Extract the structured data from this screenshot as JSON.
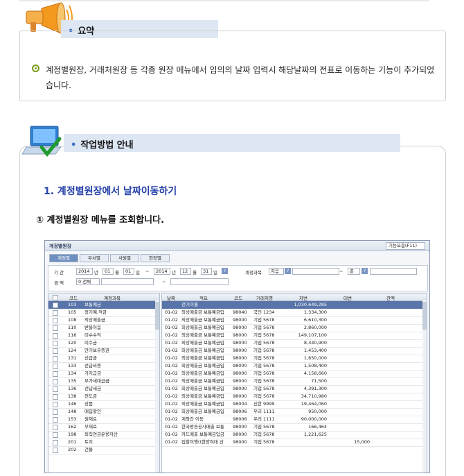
{
  "summary": {
    "title": "요약",
    "text": "계정별원장, 거래처원장 등 각종 원장 메뉴에서 임의의 날짜 입력시 해당날짜의 전표로 이동하는 기능이 추가되었습니다."
  },
  "guide": {
    "title": "작업방법 안내",
    "step_heading": "1. 계정별원장에서 날짜이동하기",
    "step_1": "① 계정별원장 메뉴를 조회합니다."
  },
  "app": {
    "window_title": "계정별원장",
    "function_button": "기능모음(F11)",
    "tabs": [
      "계정별",
      "부서별",
      "사원별",
      "현장별"
    ],
    "filter": {
      "period_label": "기 간",
      "from_year": "2014",
      "year_unit": "년",
      "from_month": "01",
      "month_unit": "월",
      "from_day": "01",
      "day_unit": "일",
      "tilde": "~",
      "to_year": "2014",
      "to_month": "12",
      "to_day": "31",
      "account_label": "계정과목",
      "account_from": "처음",
      "account_to": "끝",
      "amount_label": "금 액",
      "amount_value": "0.전체"
    },
    "left_headers": [
      "코드",
      "계정과목"
    ],
    "accounts": [
      {
        "code": "103",
        "name": "보통예금"
      },
      {
        "code": "105",
        "name": "정기예.적금"
      },
      {
        "code": "108",
        "name": "외상매출금"
      },
      {
        "code": "110",
        "name": "받을어음"
      },
      {
        "code": "116",
        "name": "미수수익"
      },
      {
        "code": "120",
        "name": "미수금"
      },
      {
        "code": "124",
        "name": "만기보유증권"
      },
      {
        "code": "131",
        "name": "선급금"
      },
      {
        "code": "133",
        "name": "선급비용"
      },
      {
        "code": "134",
        "name": "가지급금"
      },
      {
        "code": "135",
        "name": "부가세대급금"
      },
      {
        "code": "136",
        "name": "선납세금"
      },
      {
        "code": "138",
        "name": "전도금"
      },
      {
        "code": "146",
        "name": "상품"
      },
      {
        "code": "148",
        "name": "매입할인"
      },
      {
        "code": "153",
        "name": "원재료"
      },
      {
        "code": "162",
        "name": "부재료"
      },
      {
        "code": "198",
        "name": "퇴직연금운용자산"
      },
      {
        "code": "201",
        "name": "토지"
      },
      {
        "code": "202",
        "name": "건물"
      }
    ],
    "right_headers": [
      "날짜",
      "적요",
      "코드",
      "거래처명",
      "차변",
      "대변",
      "잔액"
    ],
    "entries": [
      {
        "date": "",
        "memo": "전기이월",
        "code": "",
        "partner": "",
        "debit": "1,030,649,285",
        "credit": "",
        "balance": ""
      },
      {
        "date": "01-02",
        "memo": "외상매출금 보통예금입",
        "code": "98040",
        "partner": "국민 1234",
        "debit": "1,334,300",
        "credit": "",
        "balance": ""
      },
      {
        "date": "01-02",
        "memo": "외상매출금 보통예금입",
        "code": "98000",
        "partner": "기업 5678",
        "debit": "6,610,300",
        "credit": "",
        "balance": ""
      },
      {
        "date": "01-02",
        "memo": "외상매출금 보통예금입",
        "code": "98000",
        "partner": "기업 5678",
        "debit": "2,860,000",
        "credit": "",
        "balance": ""
      },
      {
        "date": "01-02",
        "memo": "외상매출금 보통예금입",
        "code": "98000",
        "partner": "기업 5678",
        "debit": "149,107,100",
        "credit": "",
        "balance": ""
      },
      {
        "date": "01-02",
        "memo": "외상매출금 보통예금입",
        "code": "98000",
        "partner": "기업 5678",
        "debit": "8,340,900",
        "credit": "",
        "balance": ""
      },
      {
        "date": "01-02",
        "memo": "외상매출금 보통예금입",
        "code": "98000",
        "partner": "기업 5678",
        "debit": "1,453,400",
        "credit": "",
        "balance": ""
      },
      {
        "date": "01-02",
        "memo": "외상매출금 보통예금입",
        "code": "98000",
        "partner": "기업 5678",
        "debit": "1,650,000",
        "credit": "",
        "balance": ""
      },
      {
        "date": "01-02",
        "memo": "외상매출금 보통예금입",
        "code": "98000",
        "partner": "기업 5678",
        "debit": "1,508,400",
        "credit": "",
        "balance": ""
      },
      {
        "date": "01-02",
        "memo": "외상매출금 보통예금입",
        "code": "98000",
        "partner": "기업 5678",
        "debit": "4,158,660",
        "credit": "",
        "balance": ""
      },
      {
        "date": "01-02",
        "memo": "외상매출금 보통예금입",
        "code": "98000",
        "partner": "기업 5678",
        "debit": "71,500",
        "credit": "",
        "balance": ""
      },
      {
        "date": "01-02",
        "memo": "외상매출금 보통예금입",
        "code": "98000",
        "partner": "기업 5678",
        "debit": "4,391,300",
        "credit": "",
        "balance": ""
      },
      {
        "date": "01-02",
        "memo": "외상매출금 보통예금입",
        "code": "98000",
        "partner": "기업 5678",
        "debit": "34,710,980",
        "credit": "",
        "balance": ""
      },
      {
        "date": "01-02",
        "memo": "외상매출금 보통예금입",
        "code": "98004",
        "partner": "신한 9999",
        "debit": "19,464,060",
        "credit": "",
        "balance": ""
      },
      {
        "date": "01-02",
        "memo": "외상매출금 보통예금입",
        "code": "98006",
        "partner": "우리 1111",
        "debit": "950,000",
        "credit": "",
        "balance": ""
      },
      {
        "date": "01-02",
        "memo": "계좌간 이동",
        "code": "98006",
        "partner": "우리 1111",
        "debit": "90,000,000",
        "credit": "",
        "balance": ""
      },
      {
        "date": "01-02",
        "memo": "한국방송공사매출 보통",
        "code": "98000",
        "partner": "기업 5678",
        "debit": "166,464",
        "credit": "",
        "balance": ""
      },
      {
        "date": "01-02",
        "memo": "카드매출 보통예금입금",
        "code": "98000",
        "partner": "기업 5678",
        "debit": "1,221,625",
        "credit": "",
        "balance": ""
      },
      {
        "date": "01-02",
        "memo": "입찰이행((한양여대 산",
        "code": "98000",
        "partner": "기업 5678",
        "debit": "",
        "credit": "15,000",
        "balance": ""
      }
    ]
  }
}
